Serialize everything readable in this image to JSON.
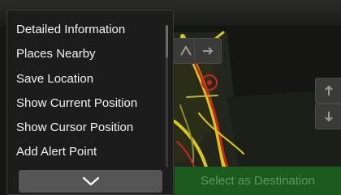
{
  "menu": {
    "items": [
      {
        "label": "Detailed Information"
      },
      {
        "label": "Places Nearby"
      },
      {
        "label": "Save Location"
      },
      {
        "label": "Show Current Position"
      },
      {
        "label": "Show Cursor Position"
      },
      {
        "label": "Add Alert Point"
      }
    ],
    "more_icon": "chevron-down-icon"
  },
  "map_controls": {
    "route_icon": "route-icon",
    "next_icon": "arrow-right-icon",
    "zoom_in_icon": "arrow-up-icon",
    "zoom_out_icon": "arrow-down-icon"
  },
  "destination_button": {
    "label": "Select as Destination"
  },
  "colors": {
    "menu_background": "#1c1c1c",
    "menu_text": "#f2f2f2",
    "map_background": "#151514",
    "destination_button": "#1d5a1d",
    "road_yellow": "#d8c818",
    "road_red": "#c8261e"
  }
}
